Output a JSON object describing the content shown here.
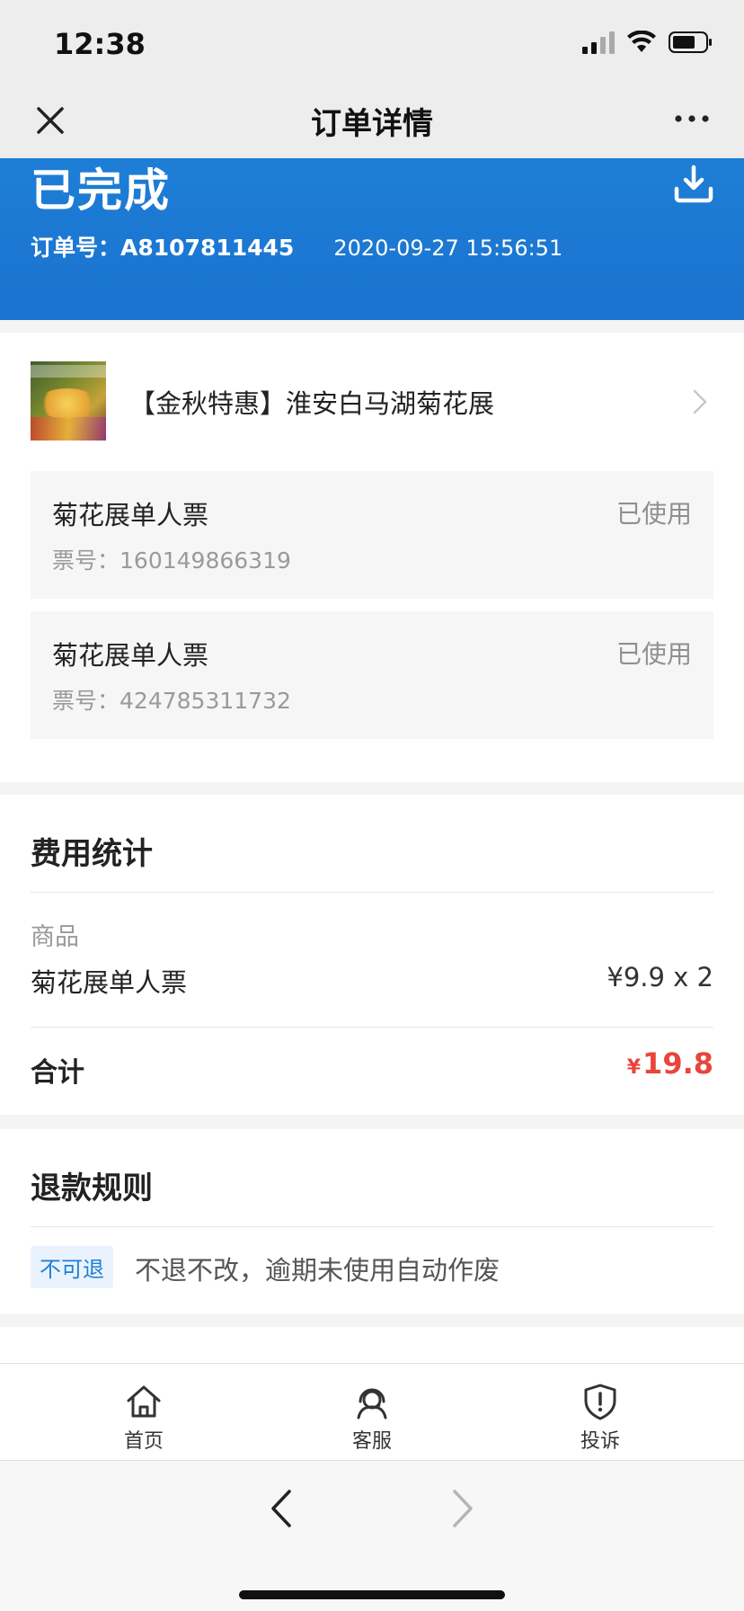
{
  "status_bar": {
    "time": "12:38"
  },
  "nav": {
    "title": "订单详情"
  },
  "order": {
    "status": "已完成",
    "number_label": "订单号：",
    "number": "A8107811445",
    "datetime": "2020-09-27 15:56:51"
  },
  "product": {
    "title": "【金秋特惠】淮安白马湖菊花展",
    "tickets": [
      {
        "name": "菊花展单人票",
        "state": "已使用",
        "no_label": "票号：",
        "no": "160149866319"
      },
      {
        "name": "菊花展单人票",
        "state": "已使用",
        "no_label": "票号：",
        "no": "424785311732"
      }
    ]
  },
  "fees": {
    "title": "费用统计",
    "goods_label": "商品",
    "item_name": "菊花展单人票",
    "item_price": "¥9.9 x 2",
    "total_label": "合计",
    "total_currency": "¥",
    "total_amount": "19.8"
  },
  "refund": {
    "title": "退款规则",
    "tag": "不可退",
    "text": "不退不改，逾期未使用自动作废"
  },
  "tabs": [
    {
      "label": "首页",
      "icon": "home-icon"
    },
    {
      "label": "客服",
      "icon": "customer-service-icon"
    },
    {
      "label": "投诉",
      "icon": "shield-alert-icon"
    }
  ],
  "colors": {
    "header_blue": "#1a73cf",
    "accent_red": "#e8453c",
    "tag_blue": "#1f7fd7"
  }
}
